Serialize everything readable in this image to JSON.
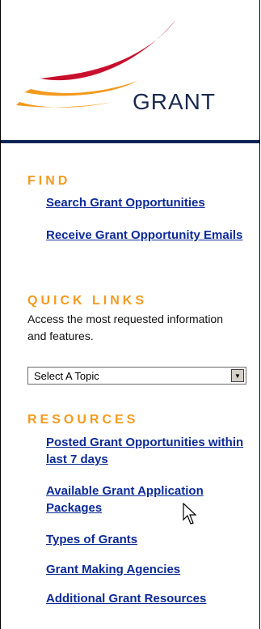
{
  "header": {
    "brand_text": "GRANT",
    "logo_colors": [
      "#c8102e",
      "#f39a1d"
    ]
  },
  "find": {
    "title": "FIND",
    "links": [
      "Search Grant Opportunities",
      "Receive Grant Opportunity Emails"
    ]
  },
  "quick_links": {
    "title": "QUICK LINKS",
    "description": "Access the most requested information and features.",
    "select_value": "Select A Topic"
  },
  "resources": {
    "title": "RESOURCES",
    "links": [
      "Posted Grant Opportunities within last 7 days",
      "Available Grant Application Packages",
      "Types of Grants",
      "Grant Making Agencies",
      "Additional Grant Resources"
    ]
  },
  "colors": {
    "accent_orange": "#f39a1d",
    "link_blue": "#0b2a97",
    "navy": "#0f2454"
  }
}
